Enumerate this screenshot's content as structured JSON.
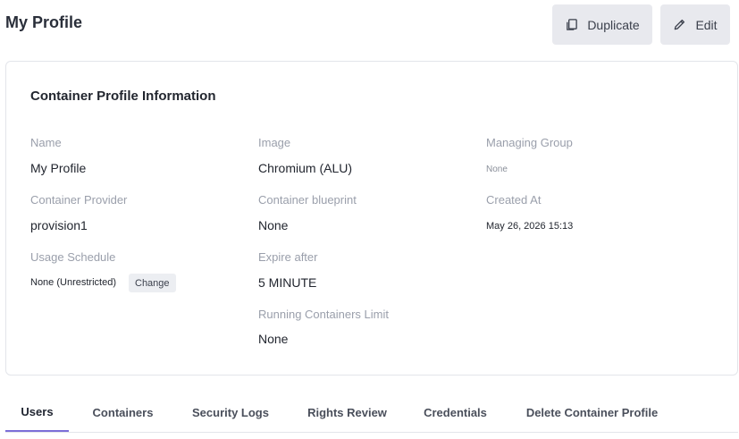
{
  "header": {
    "title": "My Profile",
    "duplicate_label": "Duplicate",
    "edit_label": "Edit"
  },
  "card": {
    "title": "Container Profile Information",
    "fields": {
      "name": {
        "label": "Name",
        "value": "My Profile"
      },
      "image": {
        "label": "Image",
        "value": "Chromium (ALU)"
      },
      "managing_group": {
        "label": "Managing Group",
        "value": "None"
      },
      "container_provider": {
        "label": "Container Provider",
        "value": "provision1"
      },
      "container_blueprint": {
        "label": "Container blueprint",
        "value": "None"
      },
      "created_at": {
        "label": "Created At",
        "value": "May 26, 2026 15:13"
      },
      "usage_schedule": {
        "label": "Usage Schedule",
        "value": "None (Unrestricted)",
        "action": "Change"
      },
      "expire_after": {
        "label": "Expire after",
        "value": "5 MINUTE"
      },
      "running_limit": {
        "label": "Running Containers Limit",
        "value": "None"
      }
    }
  },
  "tabs": [
    {
      "label": "Users",
      "active": true
    },
    {
      "label": "Containers",
      "active": false
    },
    {
      "label": "Security Logs",
      "active": false
    },
    {
      "label": "Rights Review",
      "active": false
    },
    {
      "label": "Credentials",
      "active": false
    },
    {
      "label": "Delete Container Profile",
      "active": false
    }
  ],
  "colors": {
    "accent": "#7c6fd8",
    "button_bg": "#e8e9ee",
    "label_text": "#9a9fab",
    "border": "#e3e5ea"
  },
  "icons": {
    "duplicate": "copy-icon",
    "edit": "pencil-icon"
  }
}
